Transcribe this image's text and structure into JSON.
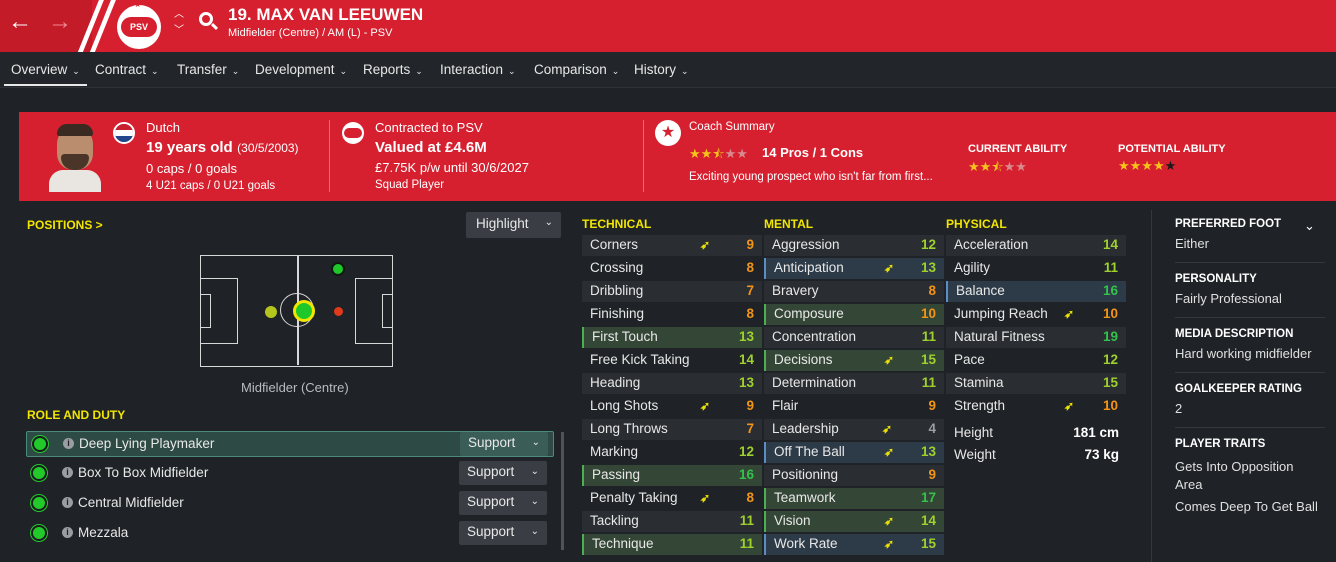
{
  "header": {
    "player_name": "19. MAX VAN LEEUWEN",
    "subtitle": "Midfielder (Centre) / AM (L) - PSV",
    "club_badge": "PSV",
    "back_icon": "arrow-left-icon",
    "forward_icon": "arrow-right-icon",
    "search_icon": "search-icon"
  },
  "tabs": [
    {
      "label": "Overview"
    },
    {
      "label": "Contract"
    },
    {
      "label": "Transfer"
    },
    {
      "label": "Development"
    },
    {
      "label": "Reports"
    },
    {
      "label": "Interaction"
    },
    {
      "label": "Comparison"
    },
    {
      "label": "History"
    }
  ],
  "banner": {
    "nationality": "Dutch",
    "age": "19 years old",
    "dob": "(30/5/2003)",
    "caps": "0 caps / 0 goals",
    "u21": "4 U21 caps / 0 U21 goals",
    "contracted": "Contracted to PSV",
    "value": "Valued at £4.6M",
    "wage": "£7.75K p/w until 30/6/2027",
    "squad_status": "Squad Player",
    "coach_title": "Coach Summary",
    "pros_cons": "14 Pros / 1 Cons",
    "coach_text": "Exciting young prospect who isn't far from first...",
    "current_ability_label": "CURRENT ABILITY",
    "potential_ability_label": "POTENTIAL ABILITY",
    "coach_stars": 2.5,
    "current_ability_stars": 2.5,
    "potential_ability_stars": 4,
    "colors": {
      "banner": "#d6202f",
      "star": "#f5c31b"
    }
  },
  "positions": {
    "title": "POSITIONS >",
    "highlight_label": "Highlight",
    "position_label": "Midfielder (Centre)"
  },
  "roles": {
    "title": "ROLE AND DUTY",
    "items": [
      {
        "name": "Deep Lying Playmaker",
        "duty": "Support"
      },
      {
        "name": "Box To Box Midfielder",
        "duty": "Support"
      },
      {
        "name": "Central Midfielder",
        "duty": "Support"
      },
      {
        "name": "Mezzala",
        "duty": "Support"
      }
    ]
  },
  "attributes": {
    "technical": {
      "title": "TECHNICAL",
      "rows": [
        {
          "name": "Corners",
          "value": "9",
          "arrow": true
        },
        {
          "name": "Crossing",
          "value": "8"
        },
        {
          "name": "Dribbling",
          "value": "7"
        },
        {
          "name": "Finishing",
          "value": "8"
        },
        {
          "name": "First Touch",
          "value": "13"
        },
        {
          "name": "Free Kick Taking",
          "value": "14"
        },
        {
          "name": "Heading",
          "value": "13"
        },
        {
          "name": "Long Shots",
          "value": "9",
          "arrow": true
        },
        {
          "name": "Long Throws",
          "value": "7"
        },
        {
          "name": "Marking",
          "value": "12"
        },
        {
          "name": "Passing",
          "value": "16"
        },
        {
          "name": "Penalty Taking",
          "value": "8",
          "arrow": true
        },
        {
          "name": "Tackling",
          "value": "11"
        },
        {
          "name": "Technique",
          "value": "11"
        }
      ]
    },
    "mental": {
      "title": "MENTAL",
      "rows": [
        {
          "name": "Aggression",
          "value": "12"
        },
        {
          "name": "Anticipation",
          "value": "13",
          "arrow": true
        },
        {
          "name": "Bravery",
          "value": "8"
        },
        {
          "name": "Composure",
          "value": "10"
        },
        {
          "name": "Concentration",
          "value": "11"
        },
        {
          "name": "Decisions",
          "value": "15",
          "arrow": true
        },
        {
          "name": "Determination",
          "value": "11"
        },
        {
          "name": "Flair",
          "value": "9"
        },
        {
          "name": "Leadership",
          "value": "4",
          "arrow": true
        },
        {
          "name": "Off The Ball",
          "value": "13",
          "arrow": true
        },
        {
          "name": "Positioning",
          "value": "9"
        },
        {
          "name": "Teamwork",
          "value": "17"
        },
        {
          "name": "Vision",
          "value": "14",
          "arrow": true
        },
        {
          "name": "Work Rate",
          "value": "15",
          "arrow": true
        }
      ]
    },
    "physical": {
      "title": "PHYSICAL",
      "rows": [
        {
          "name": "Acceleration",
          "value": "14"
        },
        {
          "name": "Agility",
          "value": "11"
        },
        {
          "name": "Balance",
          "value": "16"
        },
        {
          "name": "Jumping Reach",
          "value": "10",
          "arrow": true
        },
        {
          "name": "Natural Fitness",
          "value": "19"
        },
        {
          "name": "Pace",
          "value": "12"
        },
        {
          "name": "Stamina",
          "value": "15"
        },
        {
          "name": "Strength",
          "value": "10",
          "arrow": true
        }
      ],
      "height_label": "Height",
      "height": "181 cm",
      "weight_label": "Weight",
      "weight": "73 kg"
    }
  },
  "info": {
    "preferred_foot_label": "PREFERRED FOOT",
    "preferred_foot": "Either",
    "personality_label": "PERSONALITY",
    "personality": "Fairly Professional",
    "media_label": "MEDIA DESCRIPTION",
    "media": "Hard working midfielder",
    "gk_label": "GOALKEEPER RATING",
    "gk": "2",
    "traits_label": "PLAYER TRAITS",
    "trait1_line1": "Gets Into Opposition",
    "trait1_line2": "Area",
    "trait2": "Comes Deep To Get Ball"
  }
}
